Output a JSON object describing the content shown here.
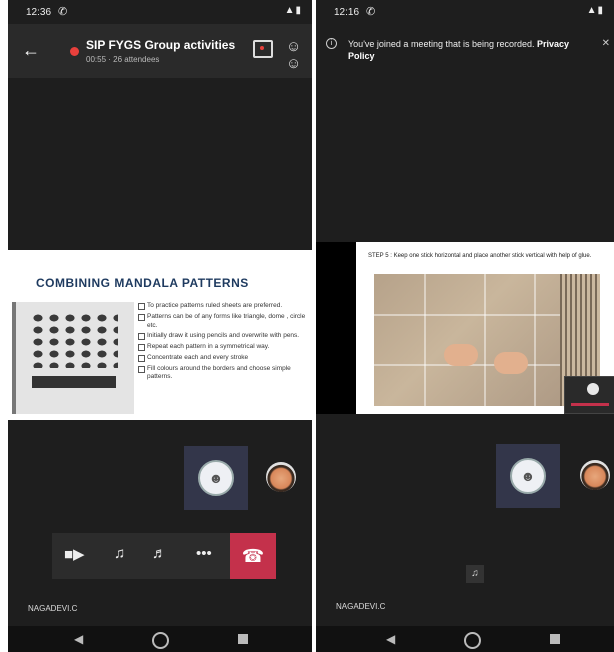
{
  "left_screen": {
    "status_time": "12:36",
    "meeting_title": "SIP FYGS Group activities s...",
    "meeting_sub": "00:55 · 26 attendees",
    "slide": {
      "title": "COMBINING MANDALA PATTERNS",
      "bullets": [
        "To practice patterns ruled sheets are preferred.",
        "Patterns can be of any forms like triangle, dome , circle etc.",
        "Initially draw it using pencils and overwrite with pens.",
        "Repeat each pattern in a symmetrical way.",
        "Concentrate each and every stroke",
        "Fill colours around the borders and choose simple patterns."
      ]
    },
    "participant_name": "NAGADEVI.C"
  },
  "right_screen": {
    "status_time": "12:16",
    "banner_text": "You've joined a meeting that is being recorded.",
    "banner_link": "Privacy Policy",
    "step_text": "STEP 5 : Keep one stick horizontal and place another stick vertical with help of glue.",
    "participant_name": "NAGADEVI.C"
  },
  "icons": {
    "back": "arrow-left-icon",
    "record": "record-dot-icon",
    "chat": "chat-icon",
    "participants": "people-icon",
    "video_off": "video-off-icon",
    "mic_off": "mic-off-icon",
    "speaker": "speaker-icon",
    "more": "more-icon",
    "hangup": "hangup-icon"
  },
  "colors": {
    "background": "#1e1e1e",
    "hangup_red": "#c4314b",
    "record_red": "#e8403c",
    "tile": "#33364a"
  }
}
